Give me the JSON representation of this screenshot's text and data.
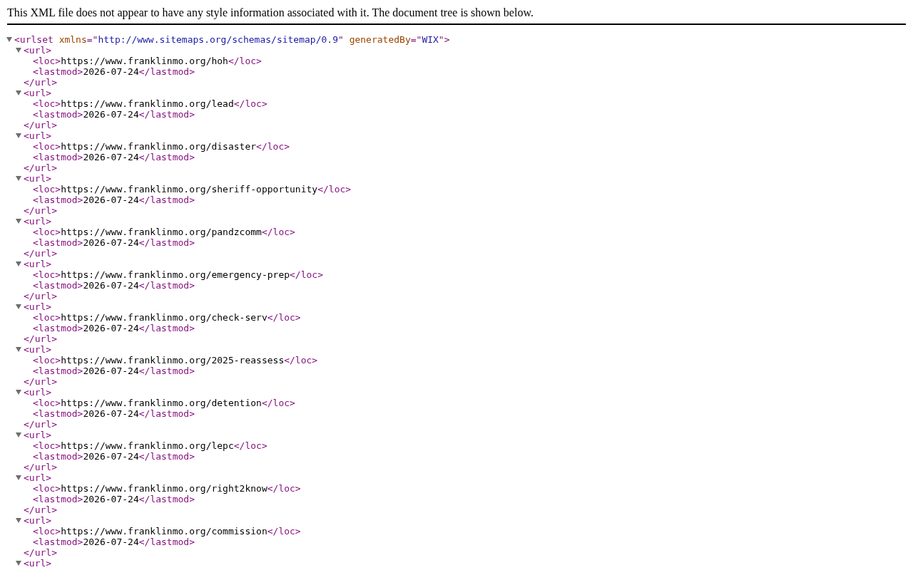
{
  "info_message": "This XML file does not appear to have any style information associated with it. The document tree is shown below.",
  "root": {
    "open": "<urlset xmlns=\"http://www.sitemaps.org/schemas/sitemap/0.9\" generatedBy=\"WIX\">",
    "expanded": true,
    "children": [
      {
        "open": "<url>",
        "expanded": true,
        "close": "</url>",
        "children": [
          {
            "line": "<loc>https://www.franklinmo.org/hoh</loc>"
          },
          {
            "line": "<lastmod>2026-07-24</lastmod>"
          }
        ]
      },
      {
        "open": "<url>",
        "expanded": true,
        "close": "</url>",
        "children": [
          {
            "line": "<loc>https://www.franklinmo.org/lead</loc>"
          },
          {
            "line": "<lastmod>2026-07-24</lastmod>"
          }
        ]
      },
      {
        "open": "<url>",
        "expanded": true,
        "close": "</url>",
        "children": [
          {
            "line": "<loc>https://www.franklinmo.org/disaster</loc>"
          },
          {
            "line": "<lastmod>2026-07-24</lastmod>"
          }
        ]
      },
      {
        "open": "<url>",
        "expanded": true,
        "close": "</url>",
        "children": [
          {
            "line": "<loc>https://www.franklinmo.org/sheriff-opportunity</loc>"
          },
          {
            "line": "<lastmod>2026-07-24</lastmod>"
          }
        ]
      },
      {
        "open": "<url>",
        "expanded": true,
        "close": "</url>",
        "children": [
          {
            "line": "<loc>https://www.franklinmo.org/pandzcomm</loc>"
          },
          {
            "line": "<lastmod>2026-07-24</lastmod>"
          }
        ]
      },
      {
        "open": "<url>",
        "expanded": true,
        "close": "</url>",
        "children": [
          {
            "line": "<loc>https://www.franklinmo.org/emergency-prep</loc>"
          },
          {
            "line": "<lastmod>2026-07-24</lastmod>"
          }
        ]
      },
      {
        "open": "<url>",
        "expanded": true,
        "close": "</url>",
        "children": [
          {
            "line": "<loc>https://www.franklinmo.org/check-serv</loc>"
          },
          {
            "line": "<lastmod>2026-07-24</lastmod>"
          }
        ]
      },
      {
        "open": "<url>",
        "expanded": true,
        "close": "</url>",
        "children": [
          {
            "line": "<loc>https://www.franklinmo.org/2025-reassess</loc>"
          },
          {
            "line": "<lastmod>2026-07-24</lastmod>"
          }
        ]
      },
      {
        "open": "<url>",
        "expanded": true,
        "close": "</url>",
        "children": [
          {
            "line": "<loc>https://www.franklinmo.org/detention</loc>"
          },
          {
            "line": "<lastmod>2026-07-24</lastmod>"
          }
        ]
      },
      {
        "open": "<url>",
        "expanded": true,
        "close": "</url>",
        "children": [
          {
            "line": "<loc>https://www.franklinmo.org/lepc</loc>"
          },
          {
            "line": "<lastmod>2026-07-24</lastmod>"
          }
        ]
      },
      {
        "open": "<url>",
        "expanded": true,
        "close": "</url>",
        "children": [
          {
            "line": "<loc>https://www.franklinmo.org/right2know</loc>"
          },
          {
            "line": "<lastmod>2026-07-24</lastmod>"
          }
        ]
      },
      {
        "open": "<url>",
        "expanded": true,
        "close": "</url>",
        "children": [
          {
            "line": "<loc>https://www.franklinmo.org/commission</loc>"
          },
          {
            "line": "<lastmod>2026-07-24</lastmod>"
          }
        ]
      },
      {
        "open": "<url>",
        "expanded": true
      }
    ]
  }
}
